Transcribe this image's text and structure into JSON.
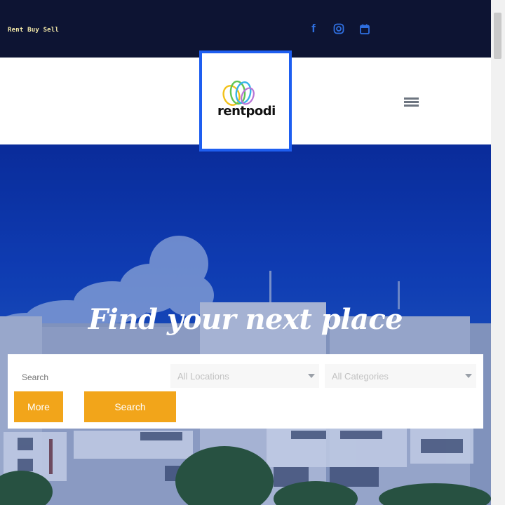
{
  "topbar": {
    "tagline": "Rent Buy Sell",
    "social_icons": [
      "facebook-icon",
      "instagram-icon",
      "calendar-icon"
    ]
  },
  "header": {
    "logo_text": "rentpodi"
  },
  "hero": {
    "title": "Find your next place"
  },
  "search": {
    "search_placeholder": "Search",
    "location_selected": "All Locations",
    "category_selected": "All Categories",
    "more_label": "More",
    "search_label": "Search"
  },
  "colors": {
    "topbar_bg": "#0d1433",
    "accent_blue": "#1e5ef0",
    "button_orange": "#f2a51a",
    "hero_blue": "#1040b8"
  }
}
